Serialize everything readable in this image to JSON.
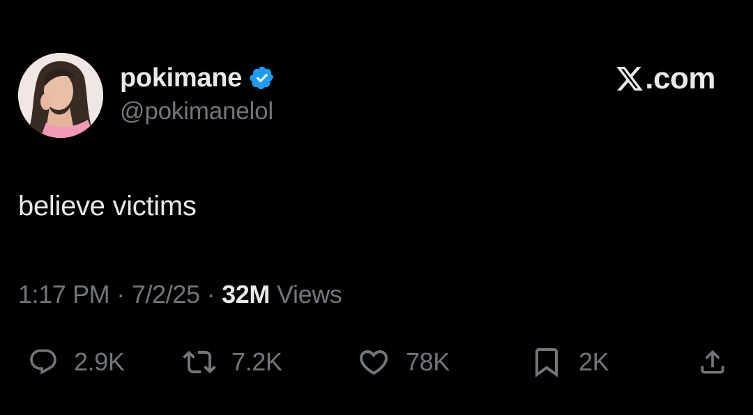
{
  "author": {
    "display_name": "pokimane",
    "handle": "@pokimanelol",
    "verified": true,
    "verified_color": "#1d9bf0"
  },
  "brand": {
    "text": ".com",
    "icon": "x-logo-icon"
  },
  "tweet": {
    "text": "believe victims"
  },
  "meta": {
    "time": "1:17 PM",
    "separator": "·",
    "date": "7/2/25",
    "views_count": "32M",
    "views_label": "Views"
  },
  "actions": {
    "reply": {
      "icon": "reply-icon",
      "count": "2.9K"
    },
    "retweet": {
      "icon": "retweet-icon",
      "count": "7.2K"
    },
    "like": {
      "icon": "heart-icon",
      "count": "78K"
    },
    "bookmark": {
      "icon": "bookmark-icon",
      "count": "2K"
    },
    "share": {
      "icon": "share-icon"
    }
  },
  "colors": {
    "background": "#000000",
    "primary_text": "#e7e9ea",
    "secondary_text": "#71767b"
  }
}
